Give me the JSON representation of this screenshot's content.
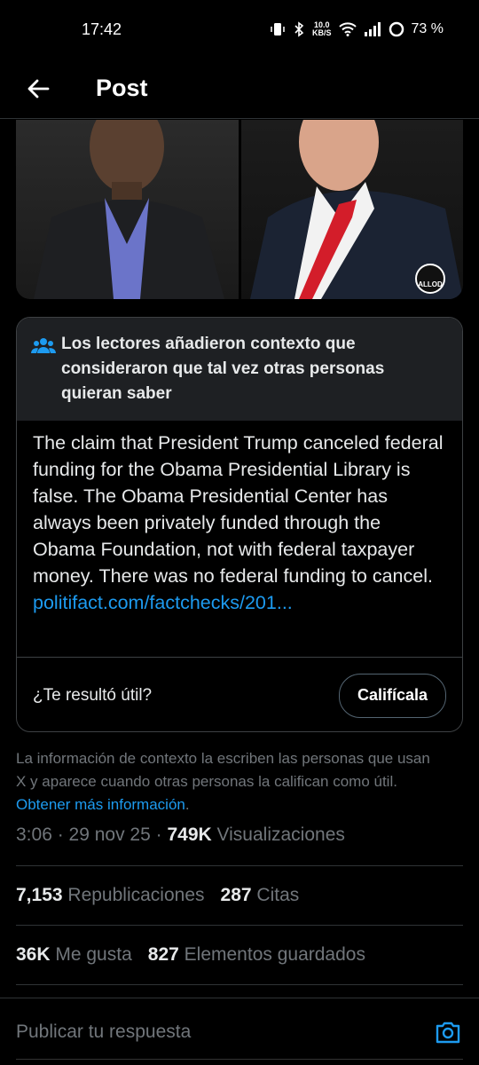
{
  "status_bar": {
    "time": "17:42",
    "net_speed_value": "10.0",
    "net_speed_unit": "KB/S",
    "battery": "73 %"
  },
  "topbar": {
    "title": "Post"
  },
  "media": {
    "watermark_text": "ALLOD"
  },
  "note": {
    "header": "Los lectores añadieron contexto que consideraron que tal vez otras personas quieran saber",
    "body": "The claim that President Trump canceled federal funding for the Obama Presidential Library is false. The Obama Presidential Center has always been privately funded through the Obama Foundation, not with federal taxpayer money. There was no federal funding to cancel. ",
    "link": "politifact.com/factchecks/201...",
    "helpful_question": "¿Te resultó útil?",
    "rate_button": "Califícala"
  },
  "disclaimer": {
    "text": "La información de contexto la escriben las personas que usan X y aparece cuando otras personas la califican como útil. ",
    "link": "Obtener más información",
    "period": "."
  },
  "meta": {
    "time": "3:06",
    "date": "29 nov 25",
    "views_count": "749K",
    "views_label": "Visualizaciones"
  },
  "stats": {
    "reposts_count": "7,153",
    "reposts_label": "Republicaciones",
    "quotes_count": "287",
    "quotes_label": "Citas",
    "likes_count": "36K",
    "likes_label": "Me gusta",
    "bookmarks_count": "827",
    "bookmarks_label": "Elementos guardados"
  },
  "reply": {
    "placeholder": "Publicar tu respuesta"
  },
  "colors": {
    "accent": "#1d9bf0",
    "background": "#000000",
    "muted": "#71767b"
  }
}
